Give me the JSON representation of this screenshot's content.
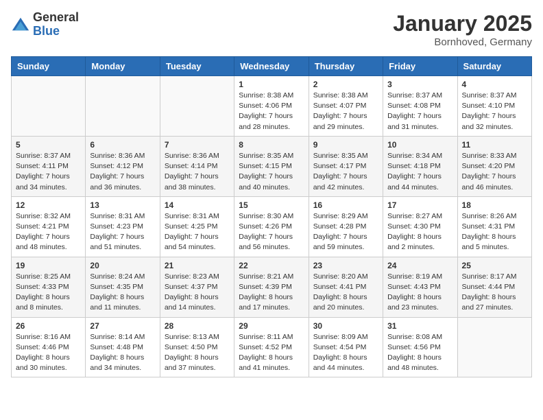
{
  "header": {
    "logo_general": "General",
    "logo_blue": "Blue",
    "month": "January 2025",
    "location": "Bornhoved, Germany"
  },
  "weekdays": [
    "Sunday",
    "Monday",
    "Tuesday",
    "Wednesday",
    "Thursday",
    "Friday",
    "Saturday"
  ],
  "weeks": [
    [
      {
        "day": "",
        "info": ""
      },
      {
        "day": "",
        "info": ""
      },
      {
        "day": "",
        "info": ""
      },
      {
        "day": "1",
        "info": "Sunrise: 8:38 AM\nSunset: 4:06 PM\nDaylight: 7 hours\nand 28 minutes."
      },
      {
        "day": "2",
        "info": "Sunrise: 8:38 AM\nSunset: 4:07 PM\nDaylight: 7 hours\nand 29 minutes."
      },
      {
        "day": "3",
        "info": "Sunrise: 8:37 AM\nSunset: 4:08 PM\nDaylight: 7 hours\nand 31 minutes."
      },
      {
        "day": "4",
        "info": "Sunrise: 8:37 AM\nSunset: 4:10 PM\nDaylight: 7 hours\nand 32 minutes."
      }
    ],
    [
      {
        "day": "5",
        "info": "Sunrise: 8:37 AM\nSunset: 4:11 PM\nDaylight: 7 hours\nand 34 minutes."
      },
      {
        "day": "6",
        "info": "Sunrise: 8:36 AM\nSunset: 4:12 PM\nDaylight: 7 hours\nand 36 minutes."
      },
      {
        "day": "7",
        "info": "Sunrise: 8:36 AM\nSunset: 4:14 PM\nDaylight: 7 hours\nand 38 minutes."
      },
      {
        "day": "8",
        "info": "Sunrise: 8:35 AM\nSunset: 4:15 PM\nDaylight: 7 hours\nand 40 minutes."
      },
      {
        "day": "9",
        "info": "Sunrise: 8:35 AM\nSunset: 4:17 PM\nDaylight: 7 hours\nand 42 minutes."
      },
      {
        "day": "10",
        "info": "Sunrise: 8:34 AM\nSunset: 4:18 PM\nDaylight: 7 hours\nand 44 minutes."
      },
      {
        "day": "11",
        "info": "Sunrise: 8:33 AM\nSunset: 4:20 PM\nDaylight: 7 hours\nand 46 minutes."
      }
    ],
    [
      {
        "day": "12",
        "info": "Sunrise: 8:32 AM\nSunset: 4:21 PM\nDaylight: 7 hours\nand 48 minutes."
      },
      {
        "day": "13",
        "info": "Sunrise: 8:31 AM\nSunset: 4:23 PM\nDaylight: 7 hours\nand 51 minutes."
      },
      {
        "day": "14",
        "info": "Sunrise: 8:31 AM\nSunset: 4:25 PM\nDaylight: 7 hours\nand 54 minutes."
      },
      {
        "day": "15",
        "info": "Sunrise: 8:30 AM\nSunset: 4:26 PM\nDaylight: 7 hours\nand 56 minutes."
      },
      {
        "day": "16",
        "info": "Sunrise: 8:29 AM\nSunset: 4:28 PM\nDaylight: 7 hours\nand 59 minutes."
      },
      {
        "day": "17",
        "info": "Sunrise: 8:27 AM\nSunset: 4:30 PM\nDaylight: 8 hours\nand 2 minutes."
      },
      {
        "day": "18",
        "info": "Sunrise: 8:26 AM\nSunset: 4:31 PM\nDaylight: 8 hours\nand 5 minutes."
      }
    ],
    [
      {
        "day": "19",
        "info": "Sunrise: 8:25 AM\nSunset: 4:33 PM\nDaylight: 8 hours\nand 8 minutes."
      },
      {
        "day": "20",
        "info": "Sunrise: 8:24 AM\nSunset: 4:35 PM\nDaylight: 8 hours\nand 11 minutes."
      },
      {
        "day": "21",
        "info": "Sunrise: 8:23 AM\nSunset: 4:37 PM\nDaylight: 8 hours\nand 14 minutes."
      },
      {
        "day": "22",
        "info": "Sunrise: 8:21 AM\nSunset: 4:39 PM\nDaylight: 8 hours\nand 17 minutes."
      },
      {
        "day": "23",
        "info": "Sunrise: 8:20 AM\nSunset: 4:41 PM\nDaylight: 8 hours\nand 20 minutes."
      },
      {
        "day": "24",
        "info": "Sunrise: 8:19 AM\nSunset: 4:43 PM\nDaylight: 8 hours\nand 23 minutes."
      },
      {
        "day": "25",
        "info": "Sunrise: 8:17 AM\nSunset: 4:44 PM\nDaylight: 8 hours\nand 27 minutes."
      }
    ],
    [
      {
        "day": "26",
        "info": "Sunrise: 8:16 AM\nSunset: 4:46 PM\nDaylight: 8 hours\nand 30 minutes."
      },
      {
        "day": "27",
        "info": "Sunrise: 8:14 AM\nSunset: 4:48 PM\nDaylight: 8 hours\nand 34 minutes."
      },
      {
        "day": "28",
        "info": "Sunrise: 8:13 AM\nSunset: 4:50 PM\nDaylight: 8 hours\nand 37 minutes."
      },
      {
        "day": "29",
        "info": "Sunrise: 8:11 AM\nSunset: 4:52 PM\nDaylight: 8 hours\nand 41 minutes."
      },
      {
        "day": "30",
        "info": "Sunrise: 8:09 AM\nSunset: 4:54 PM\nDaylight: 8 hours\nand 44 minutes."
      },
      {
        "day": "31",
        "info": "Sunrise: 8:08 AM\nSunset: 4:56 PM\nDaylight: 8 hours\nand 48 minutes."
      },
      {
        "day": "",
        "info": ""
      }
    ]
  ]
}
